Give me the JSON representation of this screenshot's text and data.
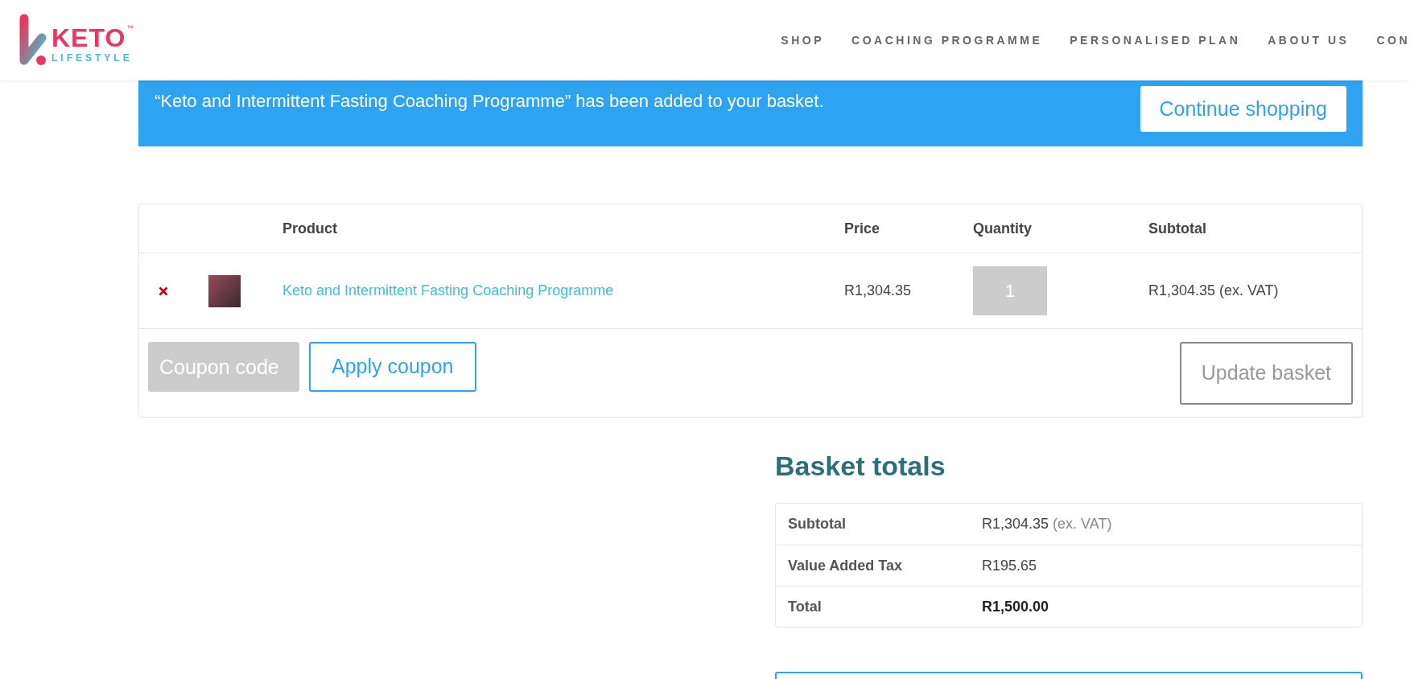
{
  "header": {
    "logo": {
      "wordmark": "KETO",
      "trademark": "™",
      "tagline": "LIFESTYLE"
    },
    "nav": [
      {
        "label": "SHOP"
      },
      {
        "label": "COACHING PROGRAMME"
      },
      {
        "label": "PERSONALISED PLAN"
      },
      {
        "label": "ABOUT US"
      },
      {
        "label": "CON"
      }
    ]
  },
  "notice": {
    "message": "“Keto and Intermittent Fasting Coaching Programme” has been added to your basket.",
    "button": "Continue shopping"
  },
  "cart": {
    "columns": [
      "Product",
      "Price",
      "Quantity",
      "Subtotal"
    ],
    "rows": [
      {
        "product": "Keto and Intermittent Fasting Coaching Programme",
        "price": "R1,304.35",
        "quantity": "1",
        "subtotal": "R1,304.35 (ex. VAT)"
      }
    ],
    "coupon": {
      "placeholder": "Coupon code",
      "button": "Apply coupon"
    },
    "update": {
      "label": "Update basket",
      "disabled": true
    }
  },
  "totals": {
    "title": "Basket totals",
    "rows": [
      {
        "label": "Subtotal",
        "value": "R1,304.35",
        "note": "(ex. VAT)",
        "kind": "amount"
      },
      {
        "label": "Value Added Tax",
        "value": "R195.65",
        "kind": "amount"
      },
      {
        "label": "Total",
        "value": "R1,500.00",
        "kind": "total"
      }
    ]
  }
}
